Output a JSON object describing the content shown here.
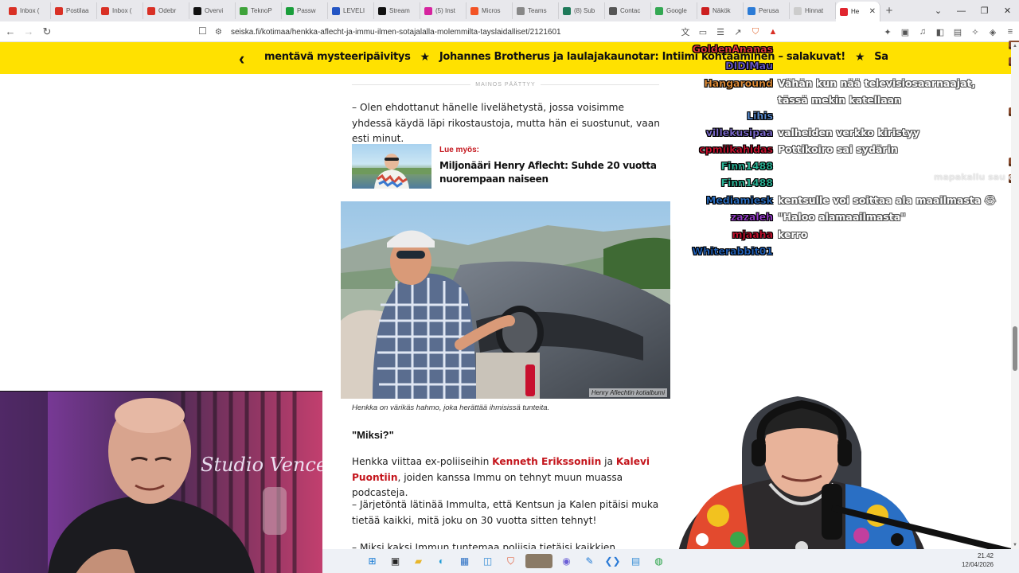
{
  "browser": {
    "tabs": [
      {
        "label": "Inbox (",
        "color": "#d93025"
      },
      {
        "label": "Postilaa",
        "color": "#d93025"
      },
      {
        "label": "Inbox (",
        "color": "#d93025"
      },
      {
        "label": "Odebr",
        "color": "#d93025"
      },
      {
        "label": "Overvi",
        "color": "#111111"
      },
      {
        "label": "TeknoP",
        "color": "#3fa33a"
      },
      {
        "label": "Passw",
        "color": "#1a9e3b"
      },
      {
        "label": "LEVELI",
        "color": "#2355c4"
      },
      {
        "label": "Stream",
        "color": "#111111"
      },
      {
        "label": "(5) Inst",
        "color": "#d6249f"
      },
      {
        "label": "Micros",
        "color": "#f35325"
      },
      {
        "label": "Teams",
        "color": "#888888"
      },
      {
        "label": "(8) Sub",
        "color": "#1f7a5a"
      },
      {
        "label": "Contac",
        "color": "#555555"
      },
      {
        "label": "Google",
        "color": "#34a853"
      },
      {
        "label": "Näkök",
        "color": "#cc1f1f"
      },
      {
        "label": "Perusa",
        "color": "#2b7bd6"
      },
      {
        "label": "Hinnat",
        "color": "#cccccc"
      },
      {
        "label": "He",
        "color": "#e0262f"
      }
    ],
    "new_tab": "+",
    "url": "seiska.fi/kotimaa/henkka-aflecht-ja-immu-ilmen-sotajalalla-molemmilta-tayslaidalliset/2121601"
  },
  "banner": {
    "back": "‹",
    "ticker": [
      "mentävä mysteeripäivitys",
      "★",
      "Johannes Brotherus ja laulajakaunotar: Intiimi kohtaaminen – salakuvat!",
      "★",
      "Sa"
    ]
  },
  "article": {
    "ad_label": "MAINOS PÄÄTTYY",
    "para1": "– Olen ehdottanut hänelle livelähetystä, jossa voisimme yhdessä käydä läpi rikostaustoja, mutta hän ei suostunut, vaan esti minut.",
    "readmore_label": "Lue myös:",
    "readmore_title": "Miljonääri Henry Aflecht: Suhde 20 vuotta nuorempaan naiseen",
    "photo_credit": "Henry Aflechtin kotialbumi",
    "caption": "Henkka on värikäs hahmo, joka herättää ihmisissä tunteita.",
    "subhead": "\"Miksi?\"",
    "para2_a": "Henkka viittaa ex-poliiseihin ",
    "para2_name1": "Kenneth Erikssoniin",
    "para2_b": " ja ",
    "para2_name2": "Kalevi Puontiin",
    "para2_c": ", joiden kanssa Immu on tehnyt muun muassa podcasteja.",
    "para3": "– Järjetöntä lätinää Immulta, että Kentsun ja Kalen pitäisi muka tietää kaikki, mitä joku on 30 vuotta sitten tehnyt!",
    "para4": "– Miksi kaksi Immun tuntemaa poliisia tietäisi kaikkien suomalaisten"
  },
  "chat": [
    {
      "user": "GoldenAnanas",
      "color": "#e83a3a",
      "msg": "",
      "emote": true
    },
    {
      "user": "DIDIMau",
      "color": "#6a5acd",
      "msg": "",
      "emote": true
    },
    {
      "user": "Hangaround",
      "color": "#e8923a",
      "msg": "Vähän kun nää televisiosaarnaajat, tässä mekin katellaan",
      "emote": false
    },
    {
      "user": "Lihis",
      "color": "#5b8fd6",
      "msg": "",
      "emote": true
    },
    {
      "user": "villekusipaa",
      "color": "#7d6bd1",
      "msg": "valheiden verkko kiristyy",
      "emote": false
    },
    {
      "user": "cpmiikahidas",
      "color": "#c8102e",
      "msg": "Pottikoiro sai sydärin",
      "emote": false
    },
    {
      "user": "Finn1488",
      "color": "#2ab89a",
      "msg": "",
      "emote": true
    },
    {
      "user": "Finn1488",
      "color": "#2ab89a",
      "msg": "",
      "emote": true
    },
    {
      "user": "Mediamiesk",
      "color": "#2a6fc4",
      "msg": "kentsulle voi soittaa ala maailmasta 😂",
      "emote": false
    },
    {
      "user": "zazaleh",
      "color": "#9b3fcf",
      "msg": "\"Haloo alamaailmasta\"",
      "emote": false
    },
    {
      "user": "mjaaha",
      "color": "#c8102e",
      "msg": "kerro",
      "emote": false
    },
    {
      "user": "Whiterabbit01",
      "color": "#1f5fb8",
      "msg": "",
      "emote": false
    }
  ],
  "chat_faint": "mapakallu sau o",
  "webcam_left": {
    "sign": "Studio Vence"
  },
  "taskbar": {
    "time": "21.42",
    "date": "12/04/2026"
  }
}
